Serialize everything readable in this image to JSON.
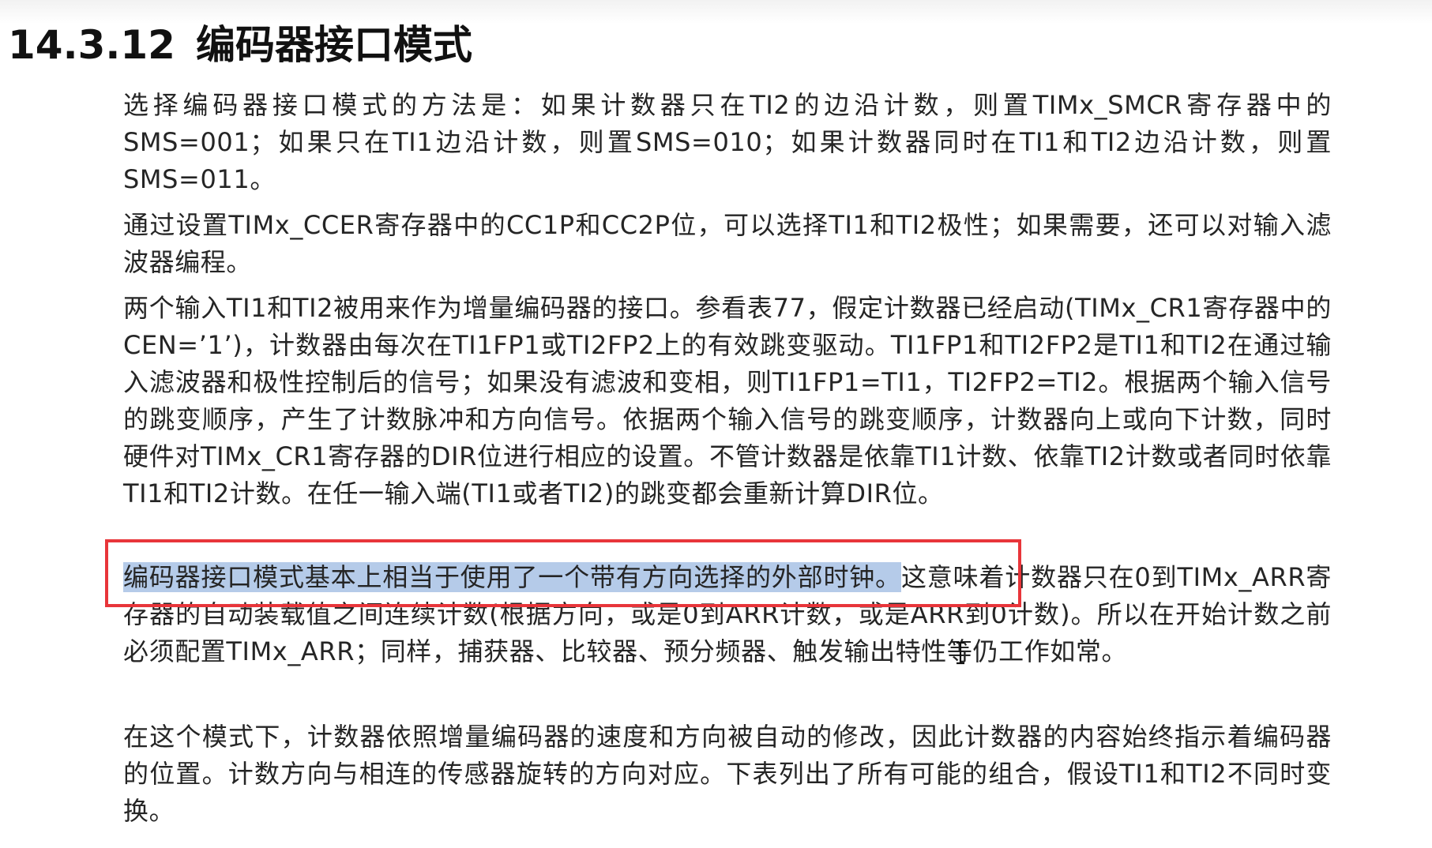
{
  "section": {
    "number": "14.3.12",
    "title": "编码器接口模式"
  },
  "paragraphs": {
    "p1": "选择编码器接口模式的方法是：如果计数器只在TI2的边沿计数，则置TIMx_SMCR寄存器中的SMS=001；如果只在TI1边沿计数，则置SMS=010；如果计数器同时在TI1和TI2边沿计数，则置SMS=011。",
    "p2": "通过设置TIMx_CCER寄存器中的CC1P和CC2P位，可以选择TI1和TI2极性；如果需要，还可以对输入滤波器编程。",
    "p3": "两个输入TI1和TI2被用来作为增量编码器的接口。参看表77，假定计数器已经启动(TIMx_CR1寄存器中的CEN=’1’)，计数器由每次在TI1FP1或TI2FP2上的有效跳变驱动。TI1FP1和TI2FP2是TI1和TI2在通过输入滤波器和极性控制后的信号；如果没有滤波和变相，则TI1FP1=TI1，TI2FP2=TI2。根据两个输入信号的跳变顺序，产生了计数脉冲和方向信号。依据两个输入信号的跳变顺序，计数器向上或向下计数，同时硬件对TIMx_CR1寄存器的DIR位进行相应的设置。不管计数器是依靠TI1计数、依靠TI2计数或者同时依靠TI1和TI2计数。在任一输入端(TI1或者TI2)的跳变都会重新计算DIR位。",
    "p4_highlighted": "编码器接口模式基本上相当于使用了一个带有方向选择的外部时钟。",
    "p4_rest": "这意味着计数器只在0到TIMx_ARR寄存器的自动装载值之间连续计数(根据方向，或是0到ARR计数，或是ARR到0计数)。所以在开始计数之前必须配置TIMx_ARR；同样，捕获器、比较器、预分频器、触发输出特性等仍工作如常。",
    "p5": "在这个模式下，计数器依照增量编码器的速度和方向被自动的修改，因此计数器的内容始终指示着编码器的位置。计数方向与相连的传感器旋转的方向对应。下表列出了所有可能的组合，假设TI1和TI2不同时变换。"
  },
  "colors": {
    "highlight": "#7aa0d7",
    "annotation_box": "#e8353a"
  },
  "icons": {
    "cursor": "text-cursor-icon"
  }
}
